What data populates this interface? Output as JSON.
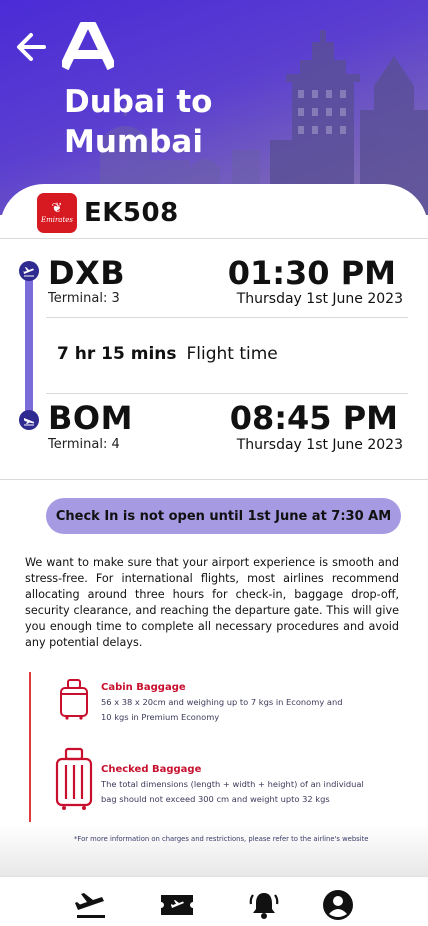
{
  "header": {
    "back_icon": "arrow-left-icon",
    "logo_icon": "app-logo-a",
    "route_title": "Dubai to Mumbai"
  },
  "flight": {
    "airline_logo_text": "Emirates",
    "flight_number": "EK508"
  },
  "departure": {
    "code": "DXB",
    "terminal": "Terminal: 3",
    "time": "01:30 PM",
    "date": "Thursday 1st June 2023",
    "icon": "plane-takeoff-icon"
  },
  "duration": {
    "value": "7 hr 15 mins",
    "label": "Flight time"
  },
  "arrival": {
    "code": "BOM",
    "terminal": "Terminal: 4",
    "time": "08:45 PM",
    "date": "Thursday 1st June 2023",
    "icon": "plane-landing-icon"
  },
  "checkin": {
    "status": "Check In is not open until 1st June at 7:30 AM"
  },
  "advice_text": "We want to make sure that your airport experience is smooth and stress-free. For international flights, most airlines recommend allocating around three hours for check-in, baggage drop-off, security clearance, and reaching the departure gate. This will give you enough time to complete all necessary procedures and avoid any potential delays.",
  "baggage": {
    "cabin": {
      "title": "Cabin Baggage",
      "line1": "56 x 38 x 20cm and weighing up to 7 kgs in Economy and",
      "line2": "10 kgs in Premium Economy",
      "icon": "cabin-bag-icon"
    },
    "checked": {
      "title": "Checked Baggage",
      "line1": "The total dimensions (length + width + height) of an individual",
      "line2": "bag should not exceed 300 cm and weight upto 32 kgs",
      "icon": "checked-bag-icon"
    },
    "footnote": "*For more information on charges and restrictions, please refer to the airline's website"
  },
  "nav": [
    {
      "icon": "flight-departure-icon"
    },
    {
      "icon": "ticket-icon"
    },
    {
      "icon": "bell-icon"
    },
    {
      "icon": "profile-icon"
    }
  ],
  "colors": {
    "header_gradient_start": "#4a2bd6",
    "timeline": "#7a6cd9",
    "checkin_pill": "#a69ae3",
    "baggage_accent": "#c8102e",
    "airline_red": "#d71921"
  }
}
